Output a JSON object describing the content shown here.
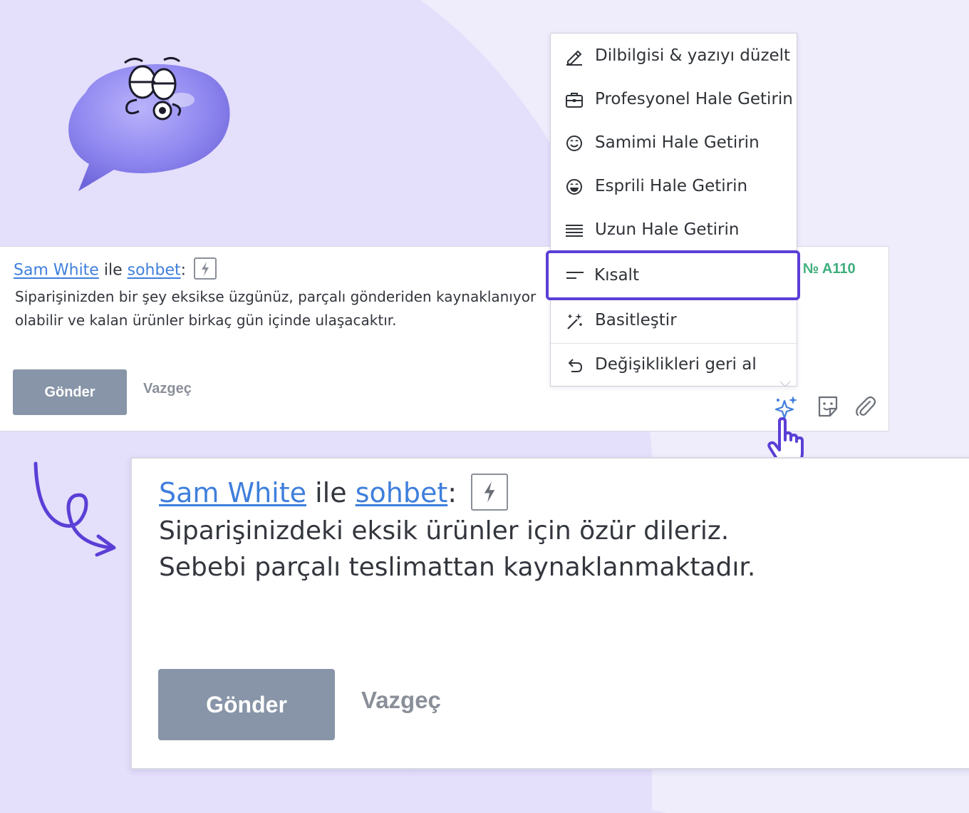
{
  "colors": {
    "background": "#e4dffb",
    "accent_purple": "#5b3fd6",
    "link_blue": "#3f7fdc",
    "send_button": "#8895a8",
    "order_green": "#3fae7c"
  },
  "composer_small": {
    "user_link": "Sam White",
    "connector": "ile",
    "chat_link": "sohbet",
    "colon": ":",
    "order_label": "n № A110",
    "message": "Siparişinizden bir şey eksikse üzgünüz, parçalı gönderiden kaynaklanıyor olabilir ve kalan ürünler birkaç gün içinde ulaşacaktır.",
    "send_label": "Gönder",
    "cancel_label": "Vazgeç",
    "toolbar_icons": [
      "ai-sparkle-icon",
      "sticker-icon",
      "paperclip-icon"
    ]
  },
  "ai_menu": {
    "items": [
      {
        "label": "Dilbilgisi & yazıyı düzelt",
        "icon": "pencil-icon"
      },
      {
        "label": "Profesyonel Hale Getirin",
        "icon": "briefcase-icon"
      },
      {
        "label": "Samimi Hale Getirin",
        "icon": "smile-icon"
      },
      {
        "label": "Esprili Hale Getirin",
        "icon": "laugh-icon"
      },
      {
        "label": "Uzun Hale Getirin",
        "icon": "lines-long-icon"
      },
      {
        "label": "Kısalt",
        "icon": "lines-short-icon",
        "selected": true
      },
      {
        "label": "Basitleştir",
        "icon": "magic-wand-icon"
      },
      {
        "label": "Değişiklikleri geri al",
        "icon": "undo-icon"
      }
    ]
  },
  "composer_big": {
    "user_link": "Sam White",
    "connector": "ile",
    "chat_link": "sohbet",
    "colon": ":",
    "message_line1": "Siparişinizdeki eksik ürünler için özür dileriz.",
    "message_line2": "Sebebi parçalı teslimattan kaynaklanmaktadır.",
    "send_label": "Gönder",
    "cancel_label": "Vazgeç"
  }
}
